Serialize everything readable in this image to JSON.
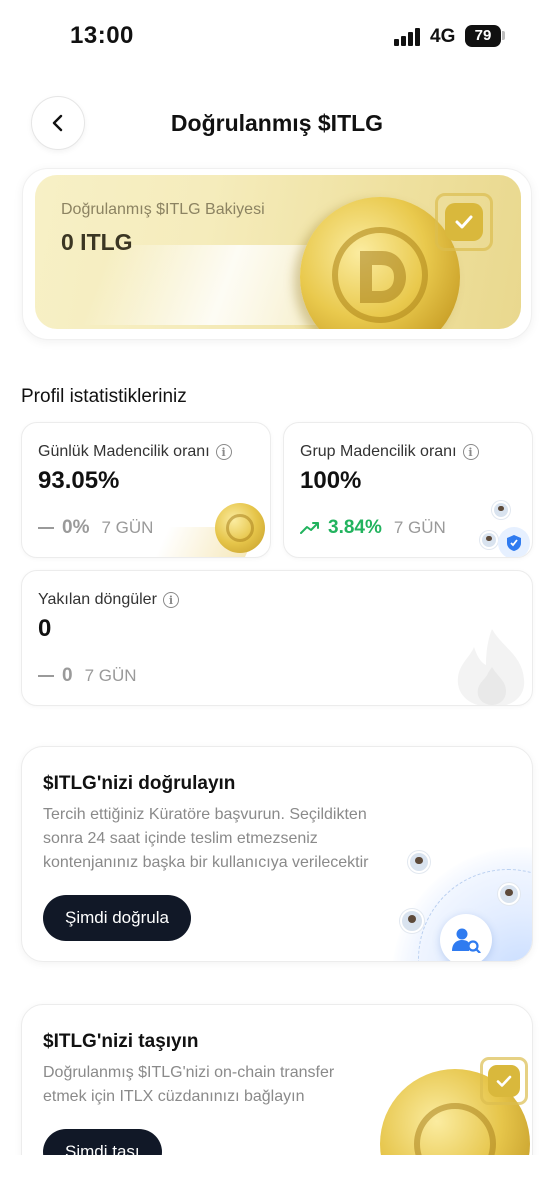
{
  "status_bar": {
    "time": "13:00",
    "network": "4G",
    "battery": "79"
  },
  "header": {
    "title": "Doğrulanmış $ITLG"
  },
  "balance": {
    "label": "Doğrulanmış $ITLG Bakiyesi",
    "value": "0 ITLG"
  },
  "stats": {
    "section_title": "Profil istatistikleriniz",
    "daily": {
      "label": "Günlük Madencilik oranı",
      "value": "93.05%",
      "change": "0%",
      "period": "7 GÜN"
    },
    "group": {
      "label": "Grup Madencilik oranı",
      "value": "100%",
      "change": "3.84%",
      "period": "7 GÜN"
    },
    "burned": {
      "label": "Yakılan döngüler",
      "value": "0",
      "change": "0",
      "period": "7 GÜN"
    }
  },
  "verify_card": {
    "title": "$ITLG'nizi doğrulayın",
    "description": "Tercih ettiğiniz Küratöre başvurun. Seçildikten sonra 24 saat içinde teslim etmezseniz kontenjanınız başka bir kullanıcıya verilecektir",
    "button": "Şimdi doğrula"
  },
  "move_card": {
    "title": "$ITLG'nizi taşıyın",
    "description": "Doğrulanmış $ITLG'nizi on-chain transfer etmek için ITLX cüzdanınızı bağlayın",
    "button": "Şimdi taşı"
  },
  "colors": {
    "positive": "#22b35e",
    "muted": "#9a9a9a",
    "button_dark": "#111827",
    "gold": "#e6c54a"
  }
}
